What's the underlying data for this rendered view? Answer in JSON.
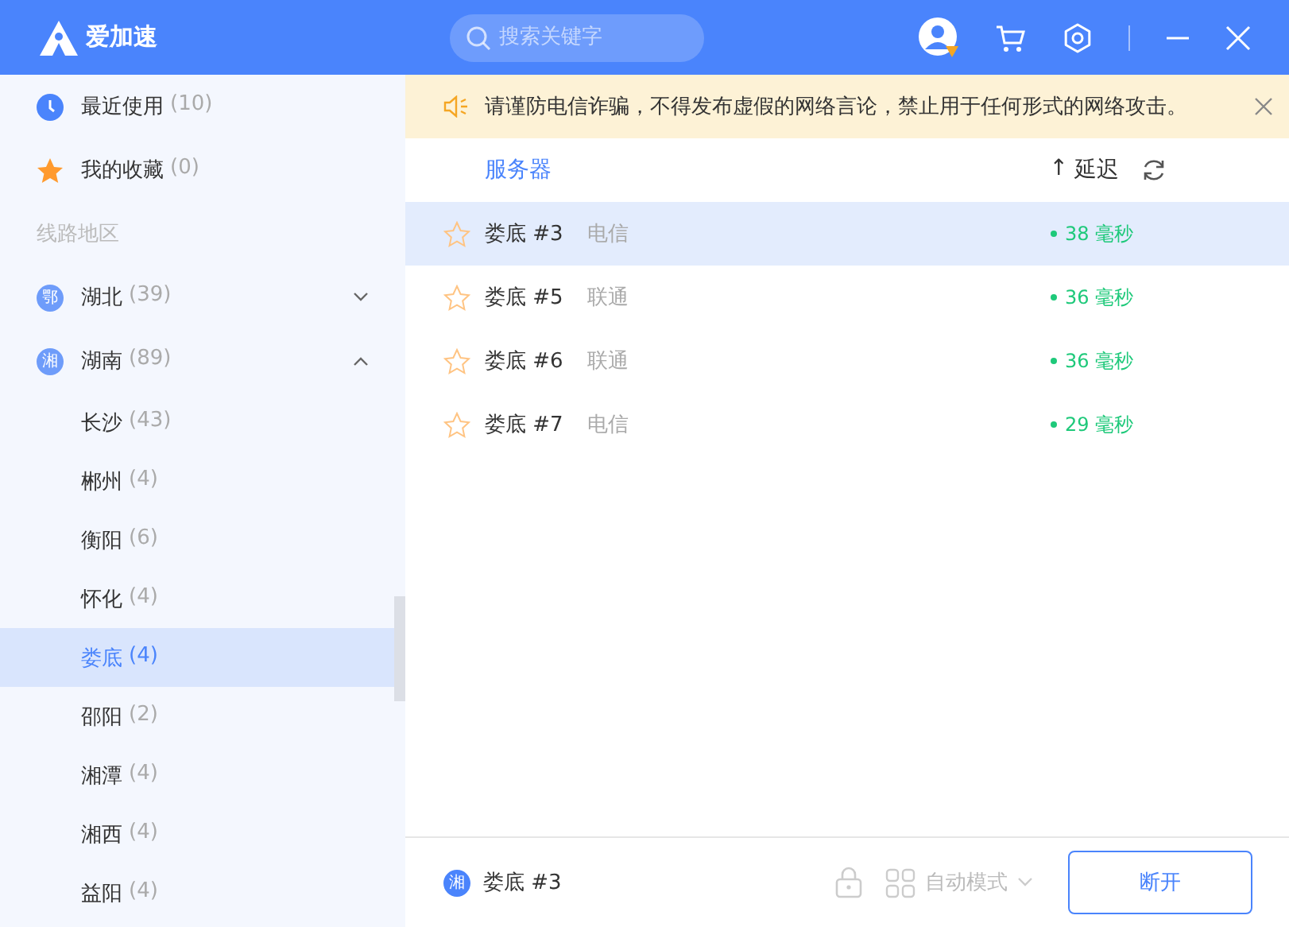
{
  "app": {
    "title": "爱加速",
    "search": {
      "placeholder": "搜索关键字"
    }
  },
  "sidebar": {
    "items": [
      {
        "kind": "recent",
        "label": "最近使用",
        "count": "(10)"
      },
      {
        "kind": "favorite",
        "label": "我的收藏",
        "count": "(0)"
      },
      {
        "kind": "section",
        "label": "线路地区"
      },
      {
        "kind": "region",
        "badge": "鄂",
        "label": "湖北",
        "count": "(39)",
        "expanded": false
      },
      {
        "kind": "region",
        "badge": "湘",
        "label": "湖南",
        "count": "(89)",
        "expanded": true,
        "children": [
          {
            "label": "长沙",
            "count": "(43)",
            "selected": false
          },
          {
            "label": "郴州",
            "count": "(4)",
            "selected": false
          },
          {
            "label": "衡阳",
            "count": "(6)",
            "selected": false
          },
          {
            "label": "怀化",
            "count": "(4)",
            "selected": false
          },
          {
            "label": "娄底",
            "count": "(4)",
            "selected": true
          },
          {
            "label": "邵阳",
            "count": "(2)",
            "selected": false
          },
          {
            "label": "湘潭",
            "count": "(4)",
            "selected": false
          },
          {
            "label": "湘西",
            "count": "(4)",
            "selected": false
          },
          {
            "label": "益阳",
            "count": "(4)",
            "selected": false
          }
        ]
      }
    ]
  },
  "notice": {
    "text": "请谨防电信诈骗，不得发布虚假的网络言论，禁止用于任何形式的网络攻击。"
  },
  "server_list": {
    "columns": {
      "server": "服务器",
      "sort_arrow": "↑",
      "latency": "延迟"
    },
    "rows": [
      {
        "name": "娄底 #3",
        "carrier": "电信",
        "latency": "38 毫秒",
        "favorite": false,
        "selected": true
      },
      {
        "name": "娄底 #5",
        "carrier": "联通",
        "latency": "36 毫秒",
        "favorite": false,
        "selected": false
      },
      {
        "name": "娄底 #6",
        "carrier": "联通",
        "latency": "36 毫秒",
        "favorite": false,
        "selected": false
      },
      {
        "name": "娄底 #7",
        "carrier": "电信",
        "latency": "29 毫秒",
        "favorite": false,
        "selected": false
      }
    ]
  },
  "status_bar": {
    "badge": "湘",
    "server": "娄底 #3",
    "mode": "自动模式",
    "disconnect": "断开"
  }
}
